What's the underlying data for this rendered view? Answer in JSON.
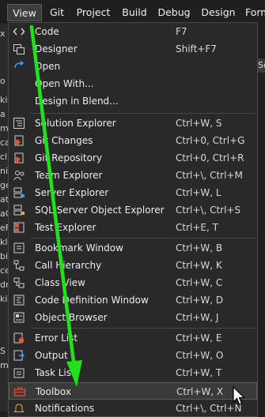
{
  "menubar": {
    "items": [
      {
        "label": "View"
      },
      {
        "label": "Git"
      },
      {
        "label": "Project"
      },
      {
        "label": "Build"
      },
      {
        "label": "Debug"
      },
      {
        "label": "Design"
      },
      {
        "label": "Form"
      }
    ]
  },
  "background": {
    "left_fragments": [
      "x",
      "o",
      "ki",
      "a",
      "m",
      "ca",
      "cl",
      "ni",
      "ge",
      "ate",
      "aG",
      "eFi",
      "kl",
      "bi",
      "ce",
      "dn",
      "ki",
      "S",
      "m"
    ],
    "right_tab": "Se"
  },
  "menu": {
    "items": [
      {
        "label": "Code",
        "shortcut": "F7",
        "icon": "code-icon"
      },
      {
        "label": "Designer",
        "shortcut": "Shift+F7",
        "icon": "designer-icon"
      },
      {
        "label": "Open",
        "shortcut": "",
        "icon": "open-arrow-icon"
      },
      {
        "label": "Open With...",
        "shortcut": "",
        "icon": ""
      },
      {
        "label": "Design in Blend...",
        "shortcut": "",
        "icon": ""
      },
      {
        "label": "Solution Explorer",
        "shortcut": "Ctrl+W, S",
        "icon": "solution-explorer-icon"
      },
      {
        "label": "Git Changes",
        "shortcut": "Ctrl+0, Ctrl+G",
        "icon": "git-changes-icon"
      },
      {
        "label": "Git Repository",
        "shortcut": "Ctrl+0, Ctrl+R",
        "icon": "git-repository-icon"
      },
      {
        "label": "Team Explorer",
        "shortcut": "Ctrl+\\, Ctrl+M",
        "icon": "team-explorer-icon"
      },
      {
        "label": "Server Explorer",
        "shortcut": "Ctrl+W, L",
        "icon": "server-explorer-icon"
      },
      {
        "label": "SQL Server Object Explorer",
        "shortcut": "Ctrl+\\, Ctrl+S",
        "icon": "sql-server-icon"
      },
      {
        "label": "Test Explorer",
        "shortcut": "Ctrl+E, T",
        "icon": "test-explorer-icon"
      },
      {
        "label": "Bookmark Window",
        "shortcut": "Ctrl+W, B",
        "icon": "bookmark-icon"
      },
      {
        "label": "Call Hierarchy",
        "shortcut": "Ctrl+W, K",
        "icon": "call-hierarchy-icon"
      },
      {
        "label": "Class View",
        "shortcut": "Ctrl+W, C",
        "icon": "class-view-icon"
      },
      {
        "label": "Code Definition Window",
        "shortcut": "Ctrl+W, D",
        "icon": "code-definition-icon"
      },
      {
        "label": "Object Browser",
        "shortcut": "Ctrl+W, J",
        "icon": "object-browser-icon"
      },
      {
        "label": "Error List",
        "shortcut": "Ctrl+W, E",
        "icon": "error-list-icon"
      },
      {
        "label": "Output",
        "shortcut": "Ctrl+W, O",
        "icon": "output-icon"
      },
      {
        "label": "Task List",
        "shortcut": "Ctrl+W, T",
        "icon": "task-list-icon"
      },
      {
        "label": "Toolbox",
        "shortcut": "Ctrl+W, X",
        "icon": "toolbox-icon"
      },
      {
        "label": "Notifications",
        "shortcut": "Ctrl+\\, Ctrl+N",
        "icon": "notifications-icon"
      }
    ]
  },
  "colors": {
    "accent_arrow": "#22e01a",
    "highlight": "#3a3a3a",
    "menu_bg": "#292929"
  }
}
